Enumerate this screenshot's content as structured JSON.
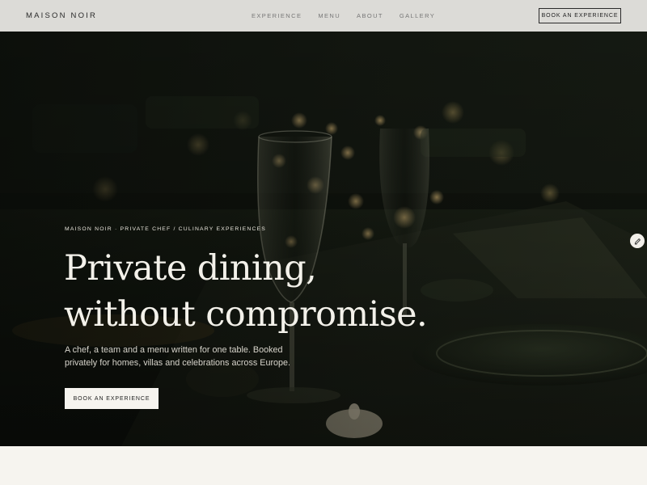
{
  "header": {
    "brand": "MAISON NOIR",
    "nav": [
      "EXPERIENCE",
      "MENU",
      "ABOUT",
      "GALLERY"
    ],
    "cta": "BOOK AN EXPERIENCE"
  },
  "hero": {
    "eyebrow": "MAISON NOIR · PRIVATE CHEF / CULINARY EXPERIENCES",
    "headline_line1": "Private dining,",
    "headline_line2": "without compromise.",
    "subtitle": "A chef, a team and a menu written for one table. Booked privately for homes, villas and celebrations across Europe.",
    "cta": "BOOK AN EXPERIENCE",
    "background_image": "wine-glass-table-photo"
  },
  "edit_icon": "pencil-icon",
  "colors": {
    "header_bg": "#dcdbd7",
    "hero_dark": "#0f120d",
    "page_bg": "#f6f4ef",
    "headline": "#f3f1ea"
  }
}
